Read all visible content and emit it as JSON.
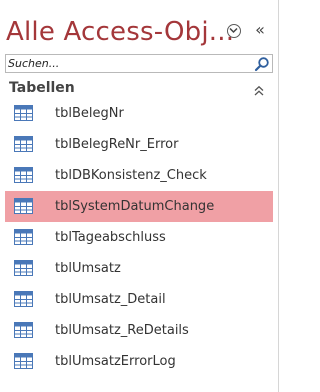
{
  "navigation_pane": {
    "title": "Alle Access-Obj...",
    "collapse_glyph": "«",
    "search": {
      "placeholder": "Suchen..."
    },
    "group": {
      "label": "Tabellen"
    },
    "items": [
      {
        "label": "tblBelegNr",
        "icon": "table-icon"
      },
      {
        "label": "tblBelegReNr_Error",
        "icon": "table-icon"
      },
      {
        "label": "tblDBKonsistenz_Check",
        "icon": "table-icon"
      },
      {
        "label": "tblSystemDatumChange",
        "icon": "table-icon",
        "selected": true
      },
      {
        "label": "tblTageabschluss",
        "icon": "table-icon"
      },
      {
        "label": "tblUmsatz",
        "icon": "table-icon"
      },
      {
        "label": "tblUmsatz_Detail",
        "icon": "table-icon"
      },
      {
        "label": "tblUmsatz_ReDetails",
        "icon": "table-icon"
      },
      {
        "label": "tblUmsatzErrorLog",
        "icon": "table-icon"
      }
    ]
  },
  "colors": {
    "title": "#a4373a",
    "selected_row": "#f0a0a5",
    "table_icon": "#4a78b8"
  }
}
